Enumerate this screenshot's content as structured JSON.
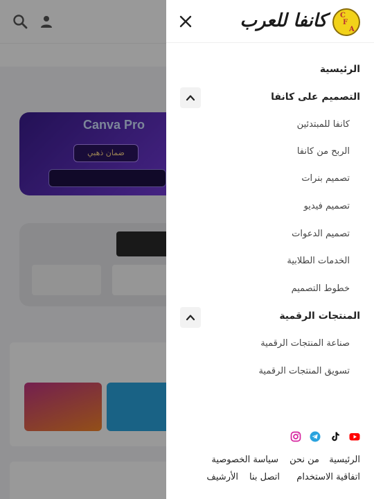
{
  "drawer": {
    "logo_text": "كانفا للعرب",
    "logo_letters": [
      "C",
      "F",
      "A"
    ],
    "menu": [
      {
        "label": "الرئيسية"
      },
      {
        "label": "التصميم على كانفا",
        "children": [
          "كانفا للمبتدئين",
          "الربح من كانفا",
          "تصميم بنرات",
          "تصميم فيديو",
          "تصميم الدعوات",
          "الخدمات الطلابية",
          "خطوط التصميم"
        ]
      },
      {
        "label": "المنتجات الرقمية",
        "children": [
          "صناعة المنتجات الرقمية",
          "تسويق المنتجات الرقمية"
        ]
      }
    ],
    "social_icons": [
      "youtube-icon",
      "tiktok-icon",
      "telegram-icon",
      "instagram-icon"
    ],
    "footer_links": [
      "الرئيسية",
      "من نحن",
      "سياسة الخصوصية",
      "اتفاقية الاستخدام",
      "اتصل بنا",
      "الأرشيف"
    ]
  },
  "background": {
    "card_title": "Canva Pro",
    "card_pill": "ضمان ذهبي"
  },
  "colors": {
    "youtube": "#ff0000",
    "tiktok": "#111111",
    "telegram": "#2aa3de",
    "instagram": "#d6249f",
    "logo_badge": "#f2d21a",
    "overlay": "rgba(0,0,0,0.40)"
  }
}
